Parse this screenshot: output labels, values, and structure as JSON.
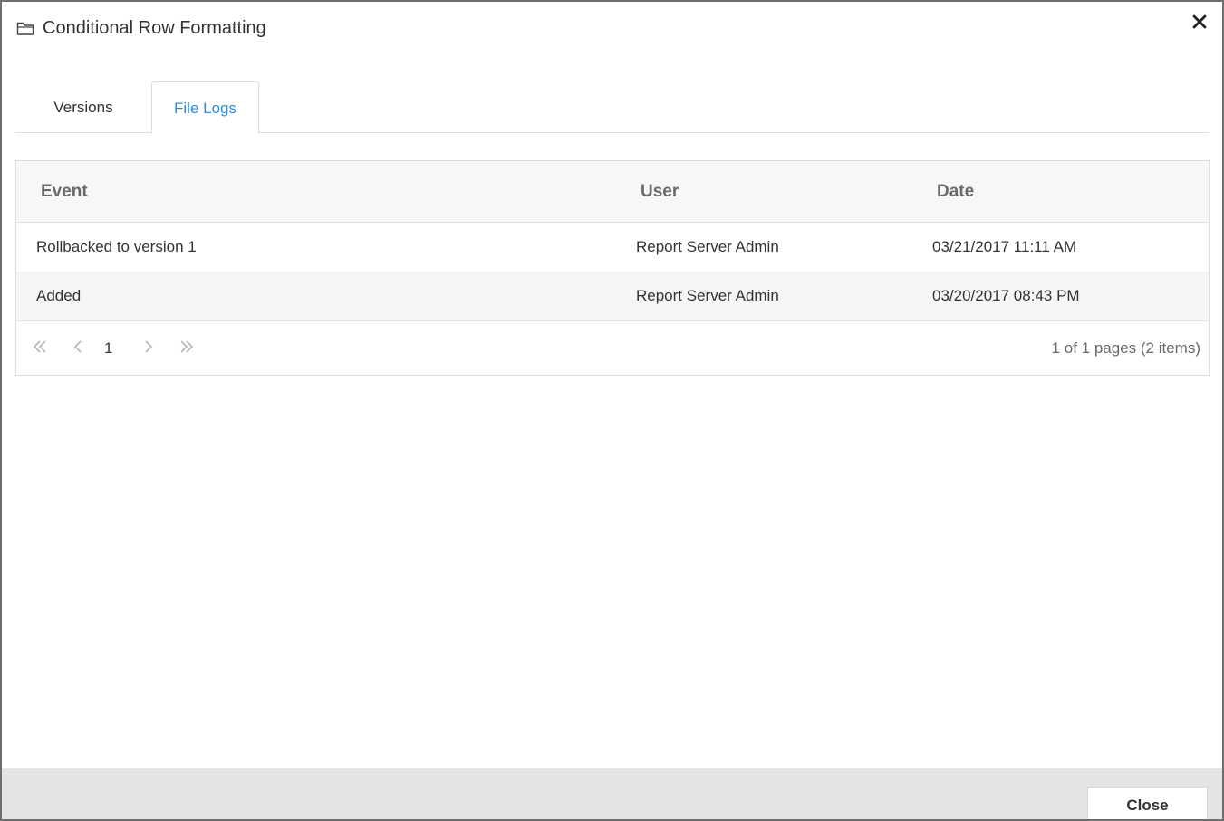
{
  "dialog": {
    "title": "Conditional Row Formatting",
    "icon": "folder-icon",
    "close_icon": "close-icon"
  },
  "tabs": [
    {
      "label": "Versions",
      "active": false
    },
    {
      "label": "File Logs",
      "active": true
    }
  ],
  "grid": {
    "columns": [
      "Event",
      "User",
      "Date"
    ],
    "rows": [
      {
        "event": "Rollbacked to version 1",
        "user": "Report Server Admin",
        "date": "03/21/2017 11:11 AM"
      },
      {
        "event": "Added",
        "user": "Report Server Admin",
        "date": "03/20/2017 08:43 PM"
      }
    ],
    "pager": {
      "current_page": "1",
      "info": "1 of 1 pages (2 items)"
    }
  },
  "footer": {
    "close_label": "Close"
  },
  "colors": {
    "accent": "#2a8ee0",
    "border": "#6e6e6e",
    "footer_bg": "#e4e4e4"
  }
}
